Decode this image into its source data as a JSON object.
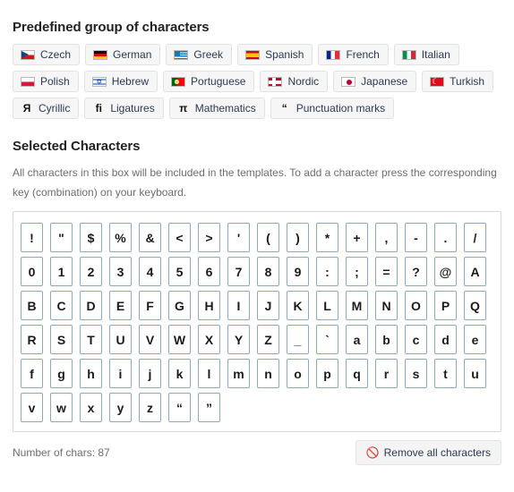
{
  "predefined": {
    "title": "Predefined group of characters",
    "rows": [
      [
        {
          "label": "Czech",
          "icon": "flag-czech-icon",
          "kind": "flag",
          "flag": "cz"
        },
        {
          "label": "German",
          "icon": "flag-german-icon",
          "kind": "flag",
          "flag": "de"
        },
        {
          "label": "Greek",
          "icon": "flag-greek-icon",
          "kind": "flag",
          "flag": "gr"
        },
        {
          "label": "Spanish",
          "icon": "flag-spanish-icon",
          "kind": "flag",
          "flag": "es"
        },
        {
          "label": "French",
          "icon": "flag-french-icon",
          "kind": "flag",
          "flag": "fr"
        },
        {
          "label": "Italian",
          "icon": "flag-italian-icon",
          "kind": "flag",
          "flag": "it"
        }
      ],
      [
        {
          "label": "Polish",
          "icon": "flag-polish-icon",
          "kind": "flag",
          "flag": "pl"
        },
        {
          "label": "Hebrew",
          "icon": "flag-israel-icon",
          "kind": "flag",
          "flag": "il"
        },
        {
          "label": "Portuguese",
          "icon": "flag-portugal-icon",
          "kind": "flag",
          "flag": "pt"
        },
        {
          "label": "Nordic",
          "icon": "flag-nordic-icon",
          "kind": "flag",
          "flag": "no"
        },
        {
          "label": "Japanese",
          "icon": "flag-japan-icon",
          "kind": "flag",
          "flag": "jp"
        },
        {
          "label": "Turkish",
          "icon": "flag-turkey-icon",
          "kind": "flag",
          "flag": "tr"
        }
      ],
      [
        {
          "label": "Cyrillic",
          "icon": "cyrillic-ya-icon",
          "kind": "glyph",
          "glyph": "Я"
        },
        {
          "label": "Ligatures",
          "icon": "ligature-fi-icon",
          "kind": "glyph",
          "glyph": "ﬁ"
        },
        {
          "label": "Mathematics",
          "icon": "pi-icon",
          "kind": "glyph",
          "glyph": "π"
        },
        {
          "label": "Punctuation marks",
          "icon": "quotation-marks-icon",
          "kind": "glyph",
          "glyph": "“"
        }
      ]
    ]
  },
  "selected": {
    "title": "Selected Characters",
    "help": "All characters in this box will be included in the templates. To add a character press the corresponding key (combination) on your keyboard.",
    "rows": [
      [
        "!",
        "\"",
        "$",
        "%",
        "&",
        "<",
        ">",
        "'",
        "(",
        ")",
        "*",
        "+",
        ",",
        "-",
        ".",
        "/"
      ],
      [
        "0",
        "1",
        "2",
        "3",
        "4",
        "5",
        "6",
        "7",
        "8",
        "9",
        ":",
        ";",
        "=",
        "?",
        "@",
        "A"
      ],
      [
        "B",
        "C",
        "D",
        "E",
        "F",
        "G",
        "H",
        "I",
        "J",
        "K",
        "L",
        "M",
        "N",
        "O",
        "P",
        "Q"
      ],
      [
        "R",
        "S",
        "T",
        "U",
        "V",
        "W",
        "X",
        "Y",
        "Z",
        "_",
        "`",
        "a",
        "b",
        "c",
        "d",
        "e"
      ],
      [
        "f",
        "g",
        "h",
        "i",
        "j",
        "k",
        "l",
        "m",
        "n",
        "o",
        "p",
        "q",
        "r",
        "s",
        "t",
        "u"
      ],
      [
        "v",
        "w",
        "x",
        "y",
        "z",
        "“",
        "”"
      ]
    ],
    "count_label": "Number of chars: 87",
    "remove_label": "Remove all characters",
    "remove_icon": "ban-icon"
  },
  "colors": {
    "key_border": "#8aa9c6",
    "box_border": "#d8d8d8",
    "button_bg": "#f6f6f6",
    "text": "#333333",
    "muted": "#6d6d6d",
    "link": "#2b3a52"
  }
}
